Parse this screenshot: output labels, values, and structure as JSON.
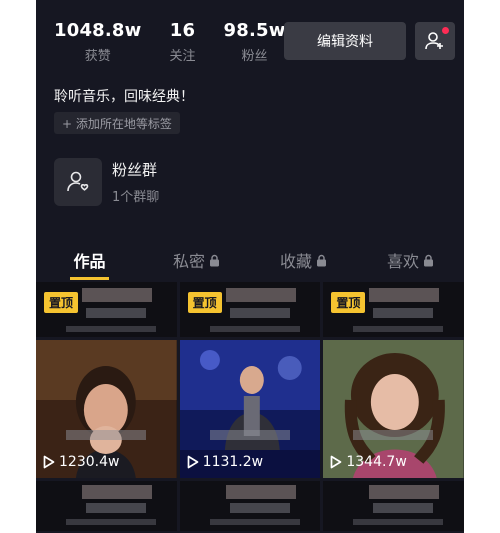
{
  "profile": {
    "stats": [
      {
        "value": "1048.8w",
        "label": "获赞"
      },
      {
        "value": "16",
        "label": "关注"
      },
      {
        "value": "98.5w",
        "label": "粉丝"
      }
    ],
    "edit_label": "编辑资料",
    "bio": "聆听音乐，回味经典！",
    "tag_chip": "+ 添加所在地等标签"
  },
  "fan_group": {
    "title": "粉丝群",
    "subtitle": "1个群聊"
  },
  "tabs": [
    {
      "label": "作品",
      "locked": false
    },
    {
      "label": "私密",
      "locked": true
    },
    {
      "label": "收藏",
      "locked": true
    },
    {
      "label": "喜欢",
      "locked": true
    }
  ],
  "videos": {
    "pinned_label": "置顶",
    "views": [
      "1230.4w",
      "1131.2w",
      "1344.7w"
    ]
  },
  "colors": {
    "background": "#161722",
    "accent": "#f5c330",
    "notification": "#fe2c55"
  }
}
